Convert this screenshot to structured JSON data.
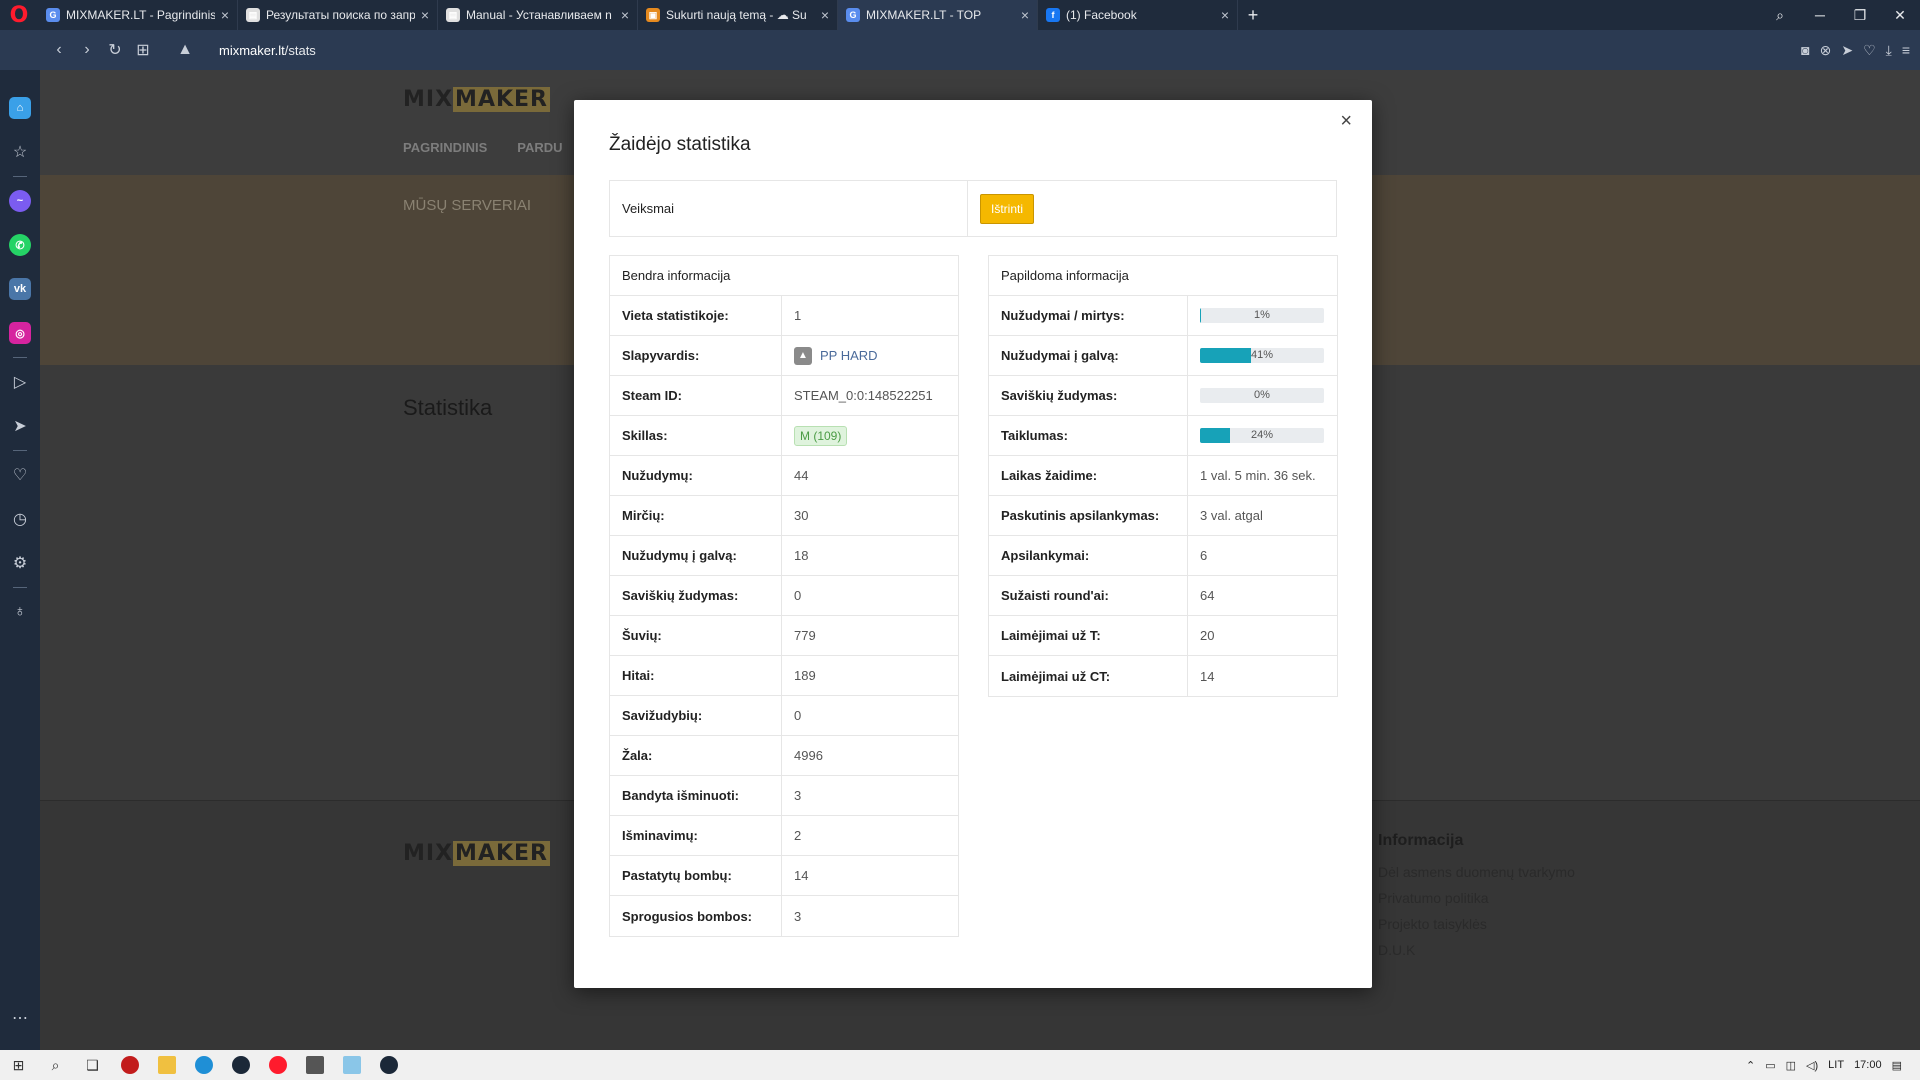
{
  "browser": {
    "tabs": [
      {
        "title": "MIXMAKER.LT - Pagrindinis",
        "icon": "g-icon",
        "color": "#5a8dee",
        "glyph": "G"
      },
      {
        "title": "Результаты поиска по запр",
        "icon": "doc-icon",
        "color": "#e0e0e0",
        "glyph": "▤"
      },
      {
        "title": "Manual - Устанавливаем n",
        "icon": "doc-icon",
        "color": "#e0e0e0",
        "glyph": "▤"
      },
      {
        "title": "Sukurti naują temą - ☁ Su",
        "icon": "forum-icon",
        "color": "#e58a1f",
        "glyph": "▣"
      },
      {
        "title": "MIXMAKER.LT - TOP",
        "icon": "g-icon",
        "color": "#5a8dee",
        "glyph": "G"
      },
      {
        "title": "(1) Facebook",
        "icon": "facebook-icon",
        "color": "#1877f2",
        "glyph": "f"
      }
    ],
    "url_host": "mixmaker.lt",
    "url_path": "/stats"
  },
  "site": {
    "nav": [
      "PAGRINDINIS",
      "PARDU"
    ],
    "banner_title": "MŪSŲ SERVERIAI",
    "stats_heading": "Statistika",
    "footer_info_title": "Informacija",
    "footer_links": [
      "Dėl asmens duomenų tvarkymo",
      "Privatumo politika",
      "Projekto taisyklės",
      "D.U.K"
    ]
  },
  "modal": {
    "title": "Žaidėjo statistika",
    "actions_label": "Veiksmai",
    "delete_label": "Ištrinti",
    "general_title": "Bendra informacija",
    "extra_title": "Papildoma informacija",
    "general": [
      {
        "k": "Vieta statistikoje:",
        "v": "1"
      },
      {
        "k": "Slapyvardis:",
        "v": "PP HARD"
      },
      {
        "k": "Steam ID:",
        "v": "STEAM_0:0:148522251"
      },
      {
        "k": "Skillas:",
        "v": "M (109)"
      },
      {
        "k": "Nužudymų:",
        "v": "44"
      },
      {
        "k": "Mirčių:",
        "v": "30"
      },
      {
        "k": "Nužudymų į galvą:",
        "v": "18"
      },
      {
        "k": "Saviškių žudymas:",
        "v": "0"
      },
      {
        "k": "Šuvių:",
        "v": "779"
      },
      {
        "k": "Hitai:",
        "v": "189"
      },
      {
        "k": "Savižudybių:",
        "v": "0"
      },
      {
        "k": "Žala:",
        "v": "4996"
      },
      {
        "k": "Bandyta išminuoti:",
        "v": "3"
      },
      {
        "k": "Išminavimų:",
        "v": "2"
      },
      {
        "k": "Pastatytų bombų:",
        "v": "14"
      },
      {
        "k": "Sprogusios bombos:",
        "v": "3"
      }
    ],
    "extra_bars": [
      {
        "k": "Nužudymai / mirtys:",
        "pct": 1,
        "label": "1%"
      },
      {
        "k": "Nužudymai į galvą:",
        "pct": 41,
        "label": "41%"
      },
      {
        "k": "Saviškių žudymas:",
        "pct": 0,
        "label": "0%"
      },
      {
        "k": "Taiklumas:",
        "pct": 24,
        "label": "24%"
      }
    ],
    "extra": [
      {
        "k": "Laikas žaidime:",
        "v": "1 val. 5 min. 36 sek."
      },
      {
        "k": "Paskutinis apsilankymas:",
        "v": "3 val. atgal"
      },
      {
        "k": "Apsilankymai:",
        "v": "6"
      },
      {
        "k": "Sužaisti round'ai:",
        "v": "64"
      },
      {
        "k": "Laimėjimai už T:",
        "v": "20"
      },
      {
        "k": "Laimėjimai už CT:",
        "v": "14"
      }
    ]
  },
  "taskbar": {
    "lang": "LIT",
    "time": "17:00"
  }
}
